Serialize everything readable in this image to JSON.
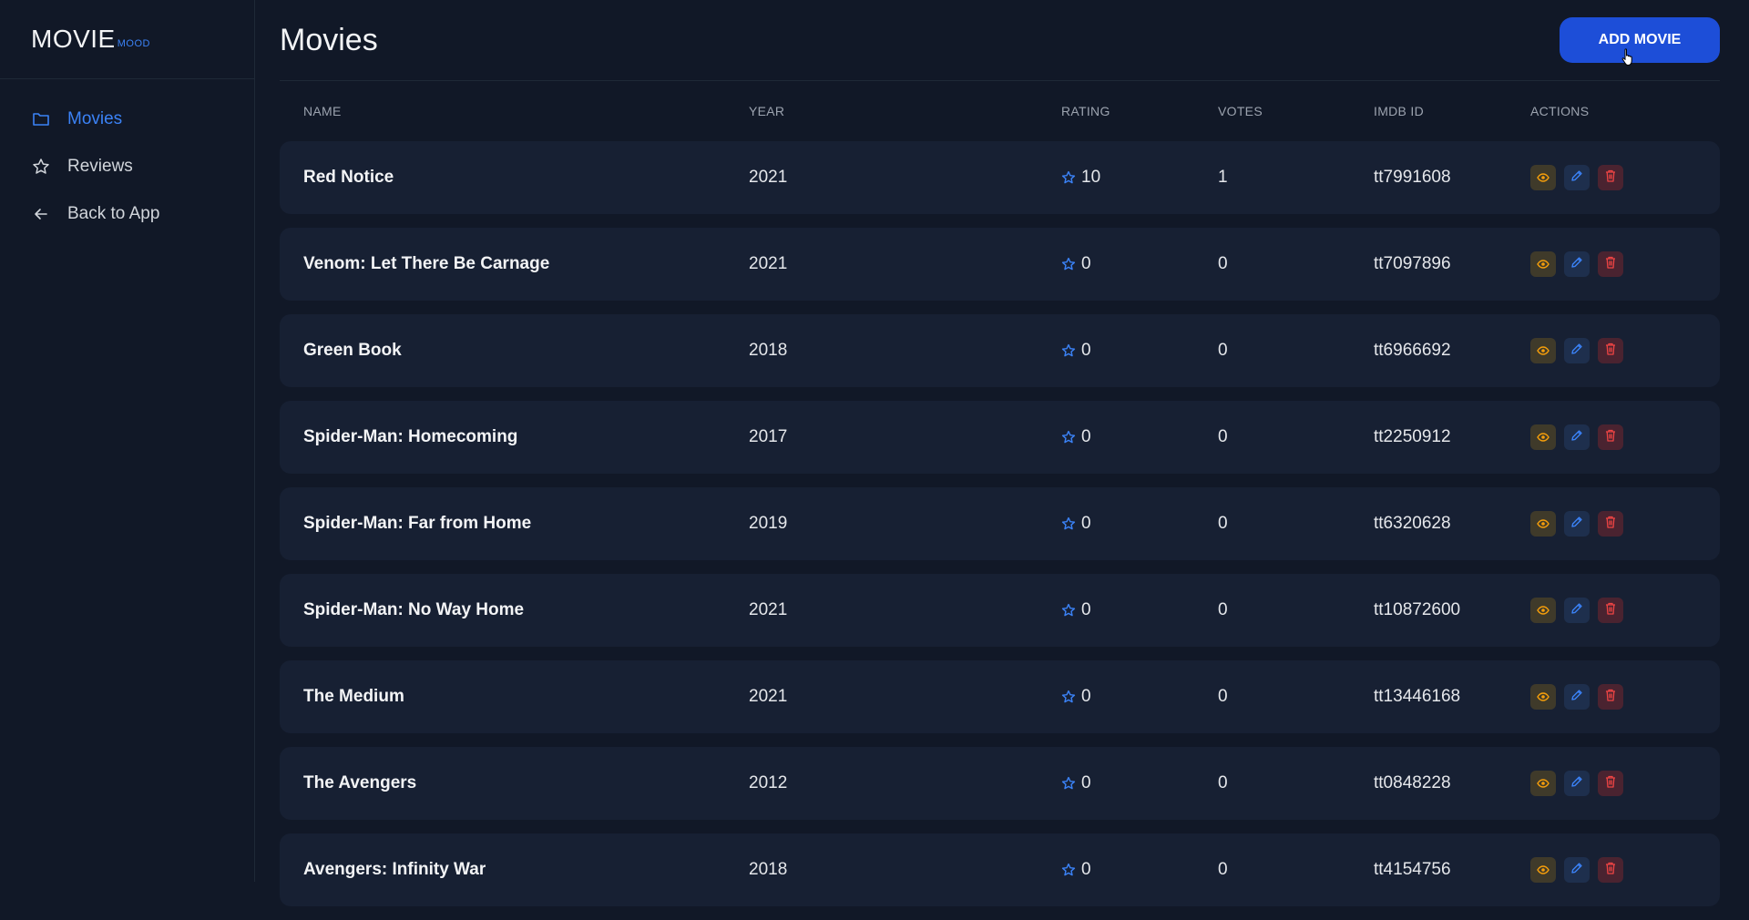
{
  "logo": {
    "main": "MOVIE",
    "sub": "MOOD"
  },
  "sidebar": {
    "items": [
      {
        "label": "Movies",
        "icon": "folder-icon",
        "active": true
      },
      {
        "label": "Reviews",
        "icon": "star-icon",
        "active": false
      },
      {
        "label": "Back to App",
        "icon": "arrow-left-icon",
        "active": false
      }
    ]
  },
  "header": {
    "title": "Movies",
    "add_button": "ADD MOVIE"
  },
  "table": {
    "columns": {
      "name": "NAME",
      "year": "YEAR",
      "rating": "RATING",
      "votes": "VOTES",
      "imdb": "IMDB ID",
      "actions": "ACTIONS"
    },
    "rows": [
      {
        "name": "Red Notice",
        "year": "2021",
        "rating": "10",
        "votes": "1",
        "imdb": "tt7991608"
      },
      {
        "name": "Venom: Let There Be Carnage",
        "year": "2021",
        "rating": "0",
        "votes": "0",
        "imdb": "tt7097896"
      },
      {
        "name": "Green Book",
        "year": "2018",
        "rating": "0",
        "votes": "0",
        "imdb": "tt6966692"
      },
      {
        "name": "Spider-Man: Homecoming",
        "year": "2017",
        "rating": "0",
        "votes": "0",
        "imdb": "tt2250912"
      },
      {
        "name": "Spider-Man: Far from Home",
        "year": "2019",
        "rating": "0",
        "votes": "0",
        "imdb": "tt6320628"
      },
      {
        "name": "Spider-Man: No Way Home",
        "year": "2021",
        "rating": "0",
        "votes": "0",
        "imdb": "tt10872600"
      },
      {
        "name": "The Medium",
        "year": "2021",
        "rating": "0",
        "votes": "0",
        "imdb": "tt13446168"
      },
      {
        "name": "The Avengers",
        "year": "2012",
        "rating": "0",
        "votes": "0",
        "imdb": "tt0848228"
      },
      {
        "name": "Avengers: Infinity War",
        "year": "2018",
        "rating": "0",
        "votes": "0",
        "imdb": "tt4154756"
      }
    ]
  },
  "colors": {
    "accent": "#3b82f6",
    "button": "#1d4ed8",
    "background": "#111827",
    "row": "#172033",
    "view": "#f59e0b",
    "edit": "#3b82f6",
    "delete": "#ef4444"
  }
}
